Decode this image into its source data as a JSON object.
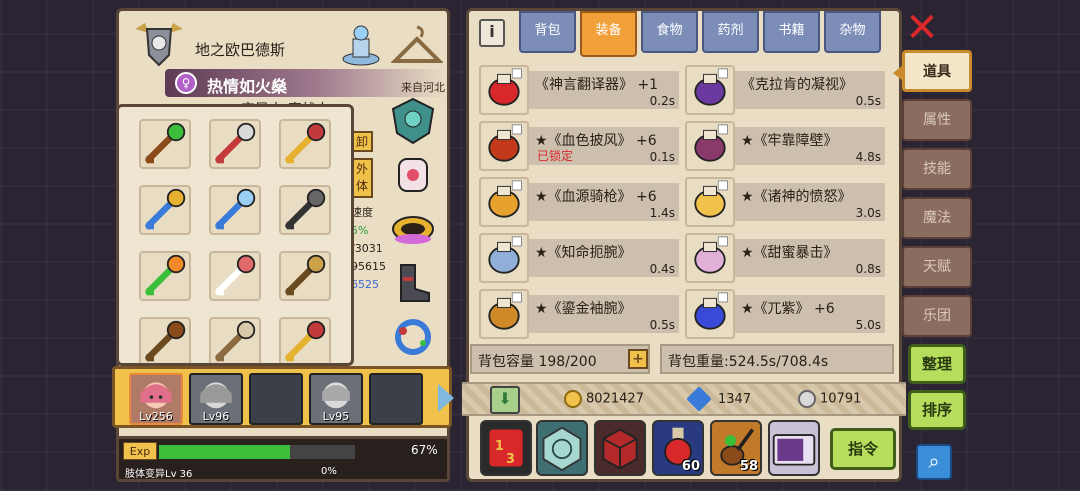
{
  "character": {
    "name": "地之欧巴德斯",
    "title": "热情如火燊",
    "origin": "来自河北",
    "subtitle": "变异人·魔战士",
    "stat_buttons": [
      "卸",
      "外 体"
    ],
    "stat_lines": [
      "速度",
      "5%",
      "/3031",
      "95615",
      "6525"
    ]
  },
  "party": {
    "members": [
      {
        "level": "Lv256",
        "active": true
      },
      {
        "level": "Lv96",
        "active": false
      },
      {
        "level": "",
        "active": false
      },
      {
        "level": "Lv95",
        "active": false
      },
      {
        "level": "",
        "active": false
      }
    ]
  },
  "exp": {
    "label": "Exp",
    "percent_text": "67%",
    "fill_fraction": 0.67,
    "mutation_label": "肢体变异Lv 36",
    "mutation_percent": "0%"
  },
  "popup_icons": [
    "green-staff-icon",
    "battle-axe-icon",
    "red-sword-icon",
    "ornate-spear-icon",
    "crescent-blade-icon",
    "stone-claw-icon",
    "pumpkin-icon",
    "red-cap-icon",
    "gauntlet-icon",
    "bag-icon",
    "horned-helm-icon",
    "flame-helm-icon"
  ],
  "inventory": {
    "tabs": [
      "背包",
      "装备",
      "食物",
      "药剂",
      "书籍",
      "杂物"
    ],
    "active_tab": 1,
    "items": [
      {
        "name": "《神言翻译器》 +1",
        "weight": "0.2s",
        "lock": "",
        "icon": "translator-helmet-icon"
      },
      {
        "name": "《克拉肯的凝视》",
        "weight": "0.5s",
        "lock": "",
        "icon": "kraken-hat-icon"
      },
      {
        "name": "★《血色披风》 +6",
        "weight": "0.1s",
        "lock": "已锁定",
        "icon": "crimson-cape-icon"
      },
      {
        "name": "★《牢靠障壁》",
        "weight": "4.8s",
        "lock": "",
        "icon": "barrier-armor-icon"
      },
      {
        "name": "★《血源骑枪》 +6",
        "weight": "1.4s",
        "lock": "",
        "icon": "lance-icon"
      },
      {
        "name": "★《诸神的愤怒》",
        "weight": "3.0s",
        "lock": "",
        "icon": "wrath-spear-icon"
      },
      {
        "name": "★《知命扼腕》",
        "weight": "0.4s",
        "lock": "",
        "icon": "fate-bracer-icon"
      },
      {
        "name": "★《甜蜜暴击》",
        "weight": "0.8s",
        "lock": "",
        "icon": "sweet-ring-icon"
      },
      {
        "name": "★《鎏金袖腕》",
        "weight": "0.5s",
        "lock": "",
        "icon": "gilded-bracer-icon"
      },
      {
        "name": "★《兀紫》 +6",
        "weight": "5.0s",
        "lock": "",
        "icon": "purple-gauntlet-icon"
      }
    ],
    "capacity": "背包容量 198/200",
    "weight": "背包重量:524.5s/708.4s"
  },
  "currency": {
    "gold": "8021427",
    "gems": "1347",
    "silver": "10791"
  },
  "toolbar": {
    "potion_count": "60",
    "guitar_count": "58",
    "command_label": "指令"
  },
  "side_menu": {
    "items": [
      "道具",
      "属性",
      "技能",
      "魔法",
      "天赋",
      "乐团"
    ],
    "active": 0
  },
  "buttons": {
    "sort_label": "整理",
    "order_label": "排序"
  },
  "colors": {
    "panel_bg": "#e9ddc4",
    "tab_active": "#f2a03a",
    "tab_inactive": "#7c8eb8",
    "lock_red": "#d8282a",
    "accent_green": "#b6dd5b"
  }
}
